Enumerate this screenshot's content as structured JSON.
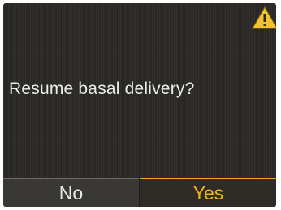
{
  "dialog": {
    "message": "Resume basal delivery?",
    "warning_icon": "warning-triangle-icon"
  },
  "buttons": {
    "no_label": "No",
    "yes_label": "Yes"
  },
  "colors": {
    "screen_background": "#2c2a26",
    "text": "#ececec",
    "accent": "#f0b51c"
  }
}
